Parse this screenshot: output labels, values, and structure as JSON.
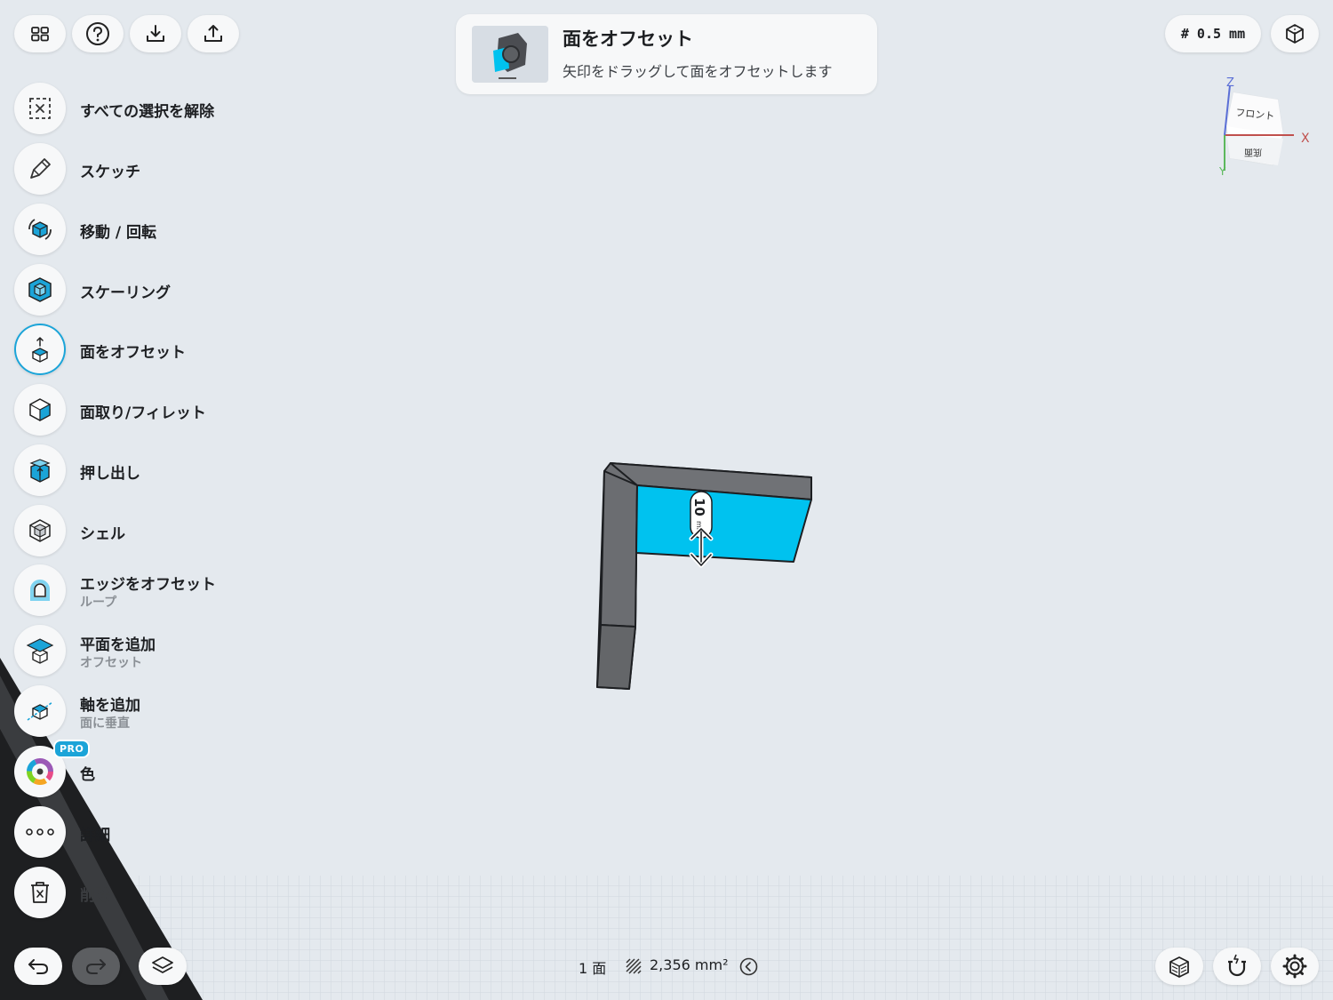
{
  "toolbar": {
    "grid_label": "# 0.5 mm"
  },
  "banner": {
    "title": "面をオフセット",
    "subtitle": "矢印をドラッグして面をオフセットします"
  },
  "tools": [
    {
      "label": "すべての選択を解除",
      "sub": ""
    },
    {
      "label": "スケッチ",
      "sub": ""
    },
    {
      "label": "移動 / 回転",
      "sub": ""
    },
    {
      "label": "スケーリング",
      "sub": ""
    },
    {
      "label": "面をオフセット",
      "sub": ""
    },
    {
      "label": "面取り/フィレット",
      "sub": ""
    },
    {
      "label": "押し出し",
      "sub": ""
    },
    {
      "label": "シェル",
      "sub": ""
    },
    {
      "label": "エッジをオフセット",
      "sub": "ループ"
    },
    {
      "label": "平面を追加",
      "sub": "オフセット"
    },
    {
      "label": "軸を追加",
      "sub": "面に垂直"
    },
    {
      "label": "色",
      "sub": ""
    },
    {
      "label": "詳細",
      "sub": ""
    },
    {
      "label": "削除",
      "sub": ""
    }
  ],
  "pro_badge": "PRO",
  "viewcube": {
    "front": "フロント",
    "bottom": "底面",
    "axis_x": "X",
    "axis_y": "Y",
    "axis_z": "Z"
  },
  "dimension": {
    "value": "10",
    "unit": "mm"
  },
  "status": {
    "faces": "1 面",
    "area": "2,356 mm²"
  },
  "colors": {
    "accent": "#1ba4d8",
    "selected_face": "#00c2ef",
    "body": "#6e7074",
    "background": "#e4e9ee"
  }
}
